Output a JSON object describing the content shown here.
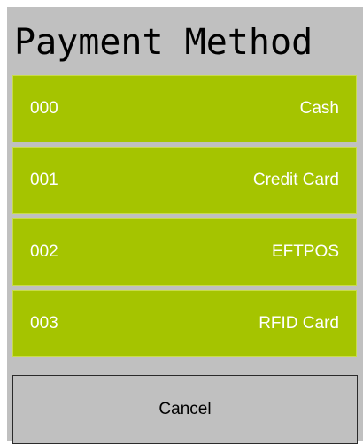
{
  "dialog": {
    "title": "Payment Method",
    "methods": [
      {
        "code": "000",
        "name": "Cash"
      },
      {
        "code": "001",
        "name": "Credit Card"
      },
      {
        "code": "002",
        "name": "EFTPOS"
      },
      {
        "code": "003",
        "name": "RFID Card"
      }
    ],
    "cancel_label": "Cancel"
  },
  "colors": {
    "panel_background": "#c0c0c0",
    "method_background": "#a5c400",
    "method_text": "#ffffff",
    "cancel_border": "#2a2a2a"
  }
}
